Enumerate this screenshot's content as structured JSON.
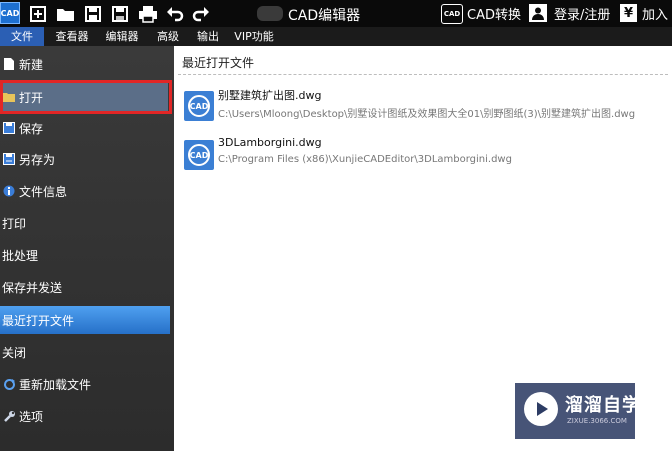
{
  "titlebar": {
    "app_logo_text": "CAD",
    "title": "CAD编辑器",
    "cad_badge": "CAD",
    "convert_label": "CAD转换",
    "login_label": "登录/注册",
    "yen_symbol": "¥",
    "join_label": "加入",
    "icons": [
      "new-file-icon",
      "open-folder-icon",
      "save-icon",
      "save-as-icon",
      "print-icon",
      "undo-icon",
      "redo-icon"
    ]
  },
  "menubar": {
    "items": [
      "文件",
      "查看器",
      "编辑器",
      "高级",
      "输出",
      "VIP功能"
    ],
    "active_index": 0
  },
  "sidebar": {
    "items": [
      {
        "label": "新建",
        "icon": "new-icon"
      },
      {
        "label": "打开",
        "icon": "open-icon"
      },
      {
        "label": "保存",
        "icon": "save-icon"
      },
      {
        "label": "另存为",
        "icon": "save-as-icon"
      },
      {
        "label": "文件信息",
        "icon": "info-icon"
      },
      {
        "label": "打印",
        "icon": ""
      },
      {
        "label": "批处理",
        "icon": ""
      },
      {
        "label": "保存并发送",
        "icon": ""
      },
      {
        "label": "最近打开文件",
        "icon": ""
      },
      {
        "label": "关闭",
        "icon": ""
      },
      {
        "label": "重新加载文件",
        "icon": "reload-icon"
      },
      {
        "label": "选项",
        "icon": "wrench-icon"
      }
    ],
    "highlighted_index": 1,
    "selected_index": 8
  },
  "recent": {
    "title": "最近打开文件",
    "files": [
      {
        "name": "别墅建筑扩出图.dwg",
        "path": "C:\\Users\\Mloong\\Desktop\\别墅设计图纸及效果图大全01\\别野图纸(3)\\别墅建筑扩出图.dwg",
        "icon_text": "CAD"
      },
      {
        "name": "3DLamborgini.dwg",
        "path": "C:\\Program Files (x86)\\XunjieCADEditor\\3DLamborgini.dwg",
        "icon_text": "CAD"
      }
    ]
  },
  "watermark": {
    "brand": "溜溜自学",
    "url": "ZIXUE.3066.COM"
  },
  "colors": {
    "accent_blue": "#2670c8",
    "highlight_red": "#e22626",
    "titlebar_bg": "#0a0a0a"
  }
}
